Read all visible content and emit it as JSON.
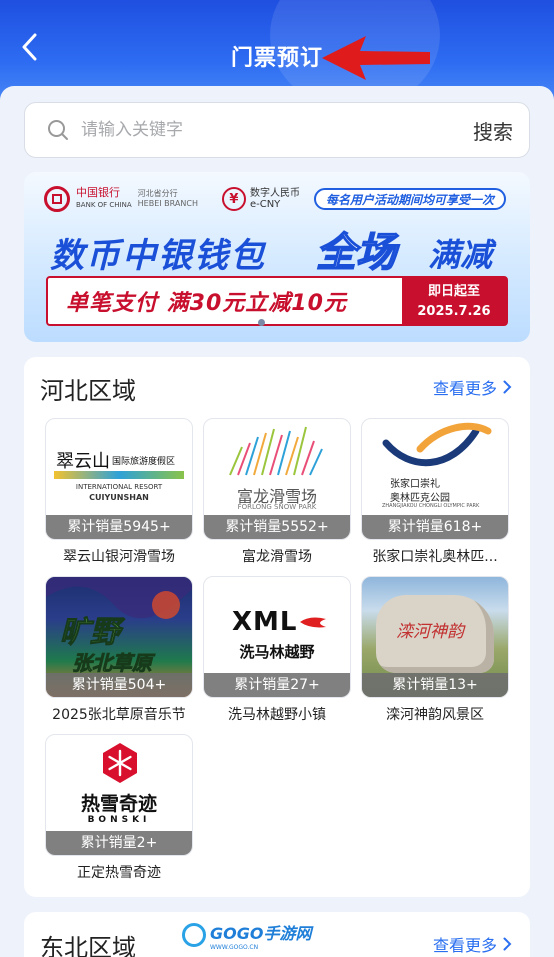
{
  "header": {
    "title": "门票预订",
    "back_icon": "chevron-left-icon",
    "colors": {
      "primary": "#2d6cf2",
      "annotation": "#e01b1b"
    }
  },
  "search": {
    "placeholder": "请输入关键字",
    "value": "",
    "button_label": "搜索",
    "icon": "search-icon"
  },
  "banner": {
    "bank_name": "中国银行",
    "bank_name_en": "BANK OF CHINA",
    "branch": "河北省分行",
    "branch_en": "HEBEI BRANCH",
    "ecny_cn": "数字人民币",
    "ecny_en": "e-CNY",
    "tag": "每名用户活动期间均可享受一次",
    "headline": "数币中银钱包",
    "headline_highlight": "全场",
    "headline_suffix": "满减",
    "offer": "单笔支付 满30元立减10元",
    "offer_date_label": "即日起至",
    "offer_date": "2025.7.26",
    "page_index": 1,
    "page_count": 1
  },
  "sections": [
    {
      "title": "河北区域",
      "more_label": "查看更多",
      "items": [
        {
          "name": "翠云山银河滑雪场",
          "sales": "累计销量5945+",
          "logo_cn": "翠云山",
          "logo_sub": "国际旅游度假区",
          "logo_en1": "INTERNATIONAL RESORT",
          "logo_en2": "CUIYUNSHAN"
        },
        {
          "name": "富龙滑雪场",
          "sales": "累计销量5552+",
          "logo_cn": "富龙滑雪场",
          "logo_en": "FORLONG SNOW PARK"
        },
        {
          "name": "张家口崇礼奥林匹...",
          "sales": "累计销量618+",
          "logo_cn1": "张家口崇礼",
          "logo_cn2": "奥林匹克公园",
          "logo_en": "ZHANGJIAKOU CHONGLI OLYMPIC PARK"
        },
        {
          "name": "2025张北草原音乐节",
          "sales": "累计销量504+",
          "logo_cn1": "旷野",
          "logo_cn2": "张北草原"
        },
        {
          "name": "洗马林越野小镇",
          "sales": "累计销量27+",
          "logo_en": "XML",
          "logo_cn": "洗马林越野"
        },
        {
          "name": "滦河神韵风景区",
          "sales": "累计销量13+",
          "stone_text": "滦河神韵"
        },
        {
          "name": "正定热雪奇迹",
          "sales": "累计销量2+",
          "logo_cn": "热雪奇迹",
          "logo_en": "BONSKI"
        }
      ]
    },
    {
      "title": "东北区域",
      "more_label": "查看更多"
    }
  ],
  "watermark": {
    "text": "GOGO手游网",
    "sub": "WWW.GOGO.CN"
  }
}
